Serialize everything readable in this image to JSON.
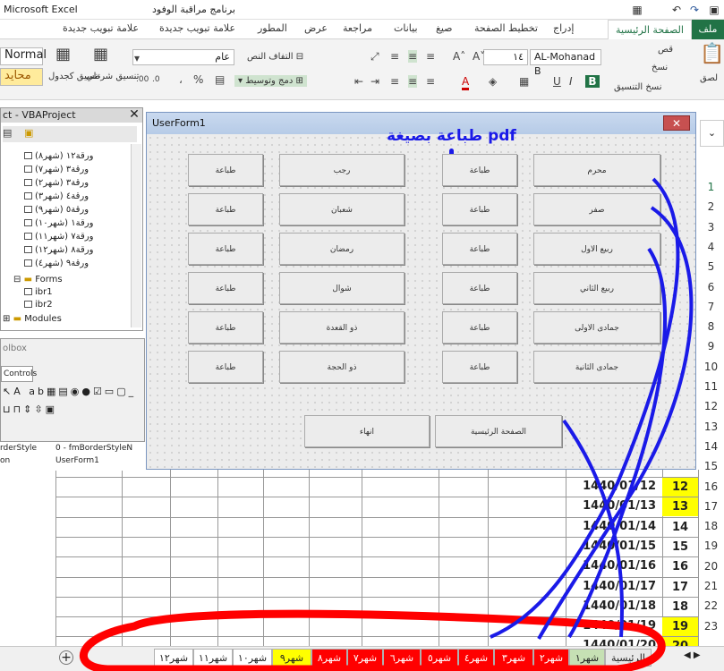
{
  "titlebar": {
    "app": "Microsoft Excel",
    "file": "برنامج مراقبة الوفود"
  },
  "ribbon_tabs": [
    "ملف",
    "الصفحة الرئيسية",
    "إدراج",
    "تخطيط الصفحة",
    "صيغ",
    "بيانات",
    "مراجعة",
    "عرض",
    "المطور",
    "علامة تبويب جديدة",
    "علامة تبويب جديدة"
  ],
  "ribbon": {
    "paste": "لصق",
    "cut": "قص",
    "copy": "نسخ",
    "format_painter": "نسخ التنسيق",
    "font_name": "AL-Mohanad B",
    "font_size": "١٤",
    "bold": "B",
    "italic": "I",
    "underline": "U",
    "wrap": "التفاف النص",
    "merge": "دمج وتوسيط",
    "number_format": "عام",
    "percent": "%",
    "comma": "،",
    "cond_format": "تنسيق شرطي",
    "format_table": "تنسيق كجدول",
    "style_normal": "Normal",
    "style_neutral": "محايد"
  },
  "vba": {
    "title": "ct - VBAProject",
    "items": [
      "ورقة١٢ (شهر٨)",
      "ورقة٣ (شهر٧)",
      "ورقة٣ (شهر٢)",
      "ورقة٤ (شهر٣)",
      "ورقة٥ (شهر٩)",
      "ورقة١ (شهر١٠)",
      "ورقة٧ (شهر١١)",
      "ورقة٨ (شهر١٢)",
      "ورقة٩ (شهر٤)"
    ],
    "forms_label": "Forms",
    "form1": "ibr1",
    "form2": "ibr2",
    "modules_label": "Modules"
  },
  "toolbox": {
    "title": "olbox",
    "tab": "Controls"
  },
  "props": {
    "row1_name": "rderStyle",
    "row1_val": "0 - fmBorderStyleN",
    "row2_name": "on",
    "row2_val": "UserForm1"
  },
  "userform": {
    "title": "UserForm1",
    "note": "طباعة بصيغة pdf",
    "months": [
      "محرم",
      "صفر",
      "ربيع الاول",
      "ربيع الثاني",
      "جمادى الاولى",
      "جمادى الثانية",
      "رجب",
      "شعبان",
      "رمضان",
      "شوال",
      "ذو القعدة",
      "ذو الحجة"
    ],
    "print_label": "طباعة",
    "home_button": "الصفحة الرئيسية",
    "end_button": "انهاء"
  },
  "grid": {
    "rows": [
      "1",
      "2",
      "3",
      "4",
      "5",
      "6",
      "7",
      "8",
      "9",
      "10",
      "11",
      "12",
      "13",
      "14",
      "15",
      "16",
      "17",
      "18",
      "19",
      "20",
      "21",
      "22",
      "23"
    ],
    "dates": [
      "1440/01/12",
      "1440/01/13",
      "1440/01/14",
      "1440/01/15",
      "1440/01/16",
      "1440/01/17",
      "1440/01/18",
      "1440/01/19",
      "1440/01/20"
    ],
    "nums": [
      "12",
      "13",
      "14",
      "15",
      "16",
      "17",
      "18",
      "19",
      "20"
    ],
    "highlight_color": "#ffff00"
  },
  "sheet_tabs": {
    "home": "الرئيسية",
    "tabs": [
      "شهر١",
      "شهر٢",
      "شهر٣",
      "شهر٤",
      "شهر٥",
      "شهر٦",
      "شهر٧",
      "شهر٨",
      "شهر٩",
      "شهر١٠",
      "شهر١١",
      "شهر١٢"
    ],
    "colors": {
      "active": "#ff0000",
      "yellow": "#ffff00",
      "home": "#e8e8e8"
    }
  },
  "colors": {
    "excel_green": "#217346",
    "annotation_blue": "#1a1ae8",
    "annotation_red": "#ff0000"
  }
}
